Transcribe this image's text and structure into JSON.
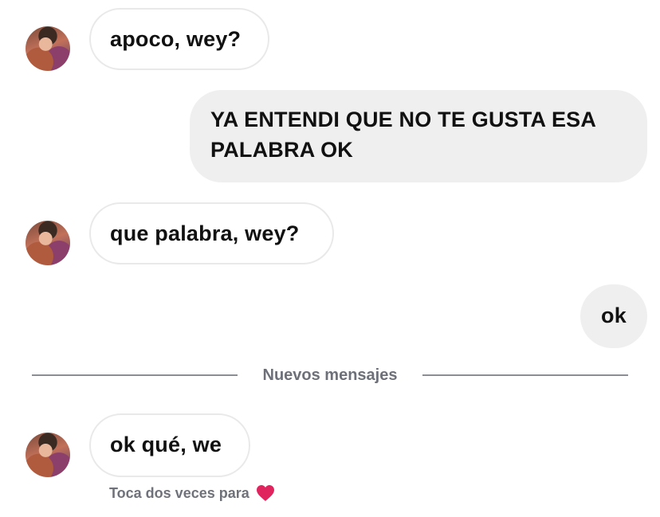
{
  "messages": [
    {
      "id": "m1",
      "direction": "incoming",
      "text": "apoco, wey?"
    },
    {
      "id": "m2",
      "direction": "outgoing",
      "line1": "YA ENTENDI QUE NO TE GUSTA ESA",
      "line2": "PALABRA OK"
    },
    {
      "id": "m3",
      "direction": "incoming",
      "text": "que palabra, wey?"
    },
    {
      "id": "m4",
      "direction": "outgoing",
      "text": "ok"
    },
    {
      "id": "m5",
      "direction": "incoming",
      "text": "ok qué, we"
    }
  ],
  "divider": {
    "label": "Nuevos mensajes"
  },
  "reaction_hint": {
    "text": "Toca dos veces para",
    "icon": "heart-icon",
    "color": "#e0245e"
  },
  "colors": {
    "incoming_border": "#e9e9e9",
    "outgoing_bg": "#efefef",
    "muted_text": "#6d7078"
  }
}
